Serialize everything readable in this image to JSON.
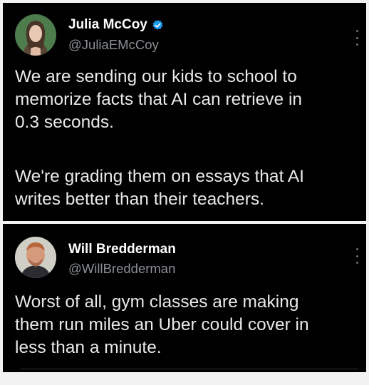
{
  "posts": [
    {
      "author_name": "Julia McCoy",
      "verified": true,
      "handle": "@JuliaEMcCoy",
      "paragraphs": [
        "We are sending our kids to school to\nmemorize facts that AI can retrieve in\n0.3 seconds.",
        "We're grading them on essays that AI\nwrites better than their teachers."
      ]
    },
    {
      "author_name": "Will Bredderman",
      "verified": false,
      "handle": "@WillBredderman",
      "paragraphs": [
        "Worst of all, gym classes are making\nthem run miles an Uber could cover in\nless than a minute."
      ]
    }
  ],
  "icons": {
    "verified": "verified-badge-icon",
    "more": "more-options-icon"
  },
  "colors": {
    "background": "#000000",
    "page": "#f2f2f2",
    "text": "#e7e9ea",
    "handle": "#8b8f94",
    "verified_blue": "#1d9bf0"
  }
}
